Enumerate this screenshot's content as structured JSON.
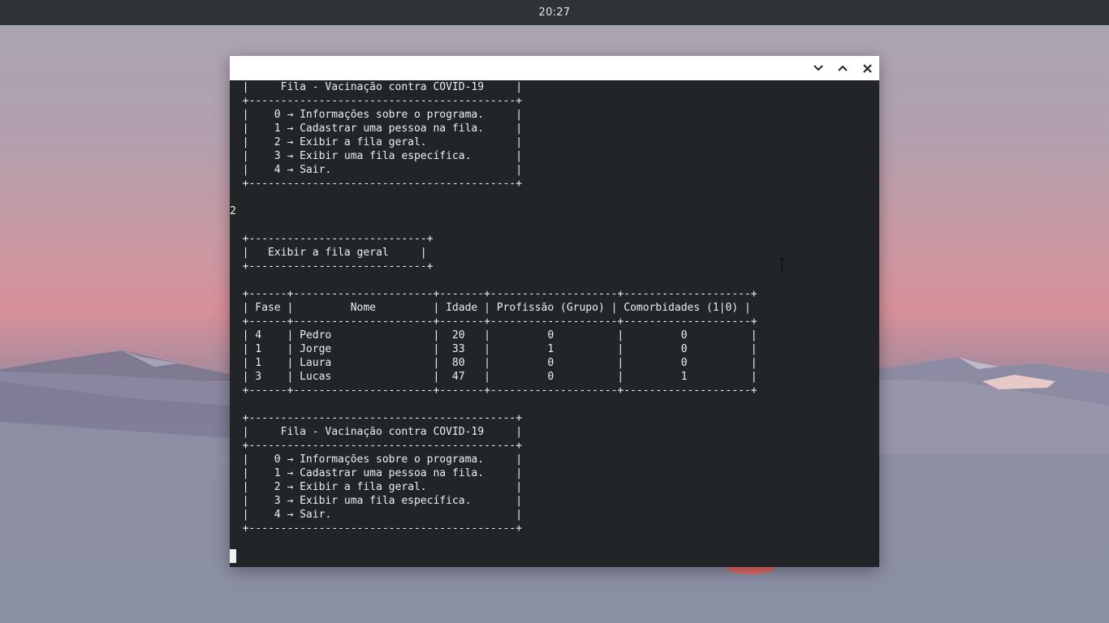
{
  "topbar": {
    "clock": "20:27"
  },
  "window": {
    "controls": {
      "minimize": "minimize",
      "maximize": "maximize",
      "close": "close"
    }
  },
  "terminal": {
    "lines": [
      "  |     Fila - Vacinação contra COVID-19     |",
      "  +------------------------------------------+",
      "  |    0 → Informações sobre o programa.     |",
      "  |    1 → Cadastrar uma pessoa na fila.     |",
      "  |    2 → Exibir a fila geral.              |",
      "  |    3 → Exibir uma fila específica.       |",
      "  |    4 → Sair.                             |",
      "  +------------------------------------------+",
      "",
      "2",
      "",
      "  +----------------------------+",
      "  |   Exibir a fila geral     |",
      "  +----------------------------+",
      "",
      "  +------+----------------------+-------+--------------------+--------------------+",
      "  | Fase |         Nome         | Idade | Profissão (Grupo) | Comorbidades (1|0) |",
      "  +------+----------------------+-------+--------------------+--------------------+",
      "  | 4    | Pedro                |  20   |         0          |         0          |",
      "  | 1    | Jorge                |  33   |         1          |         0          |",
      "  | 1    | Laura                |  80   |         0          |         0          |",
      "  | 3    | Lucas                |  47   |         0          |         1          |",
      "  +------+----------------------+-------+--------------------+--------------------+",
      "",
      "  +------------------------------------------+",
      "  |     Fila - Vacinação contra COVID-19     |",
      "  +------------------------------------------+",
      "  |    0 → Informações sobre o programa.     |",
      "  |    1 → Cadastrar uma pessoa na fila.     |",
      "  |    2 → Exibir a fila geral.              |",
      "  |    3 → Exibir uma fila específica.       |",
      "  |    4 → Sair.                             |",
      "  +------------------------------------------+"
    ]
  }
}
